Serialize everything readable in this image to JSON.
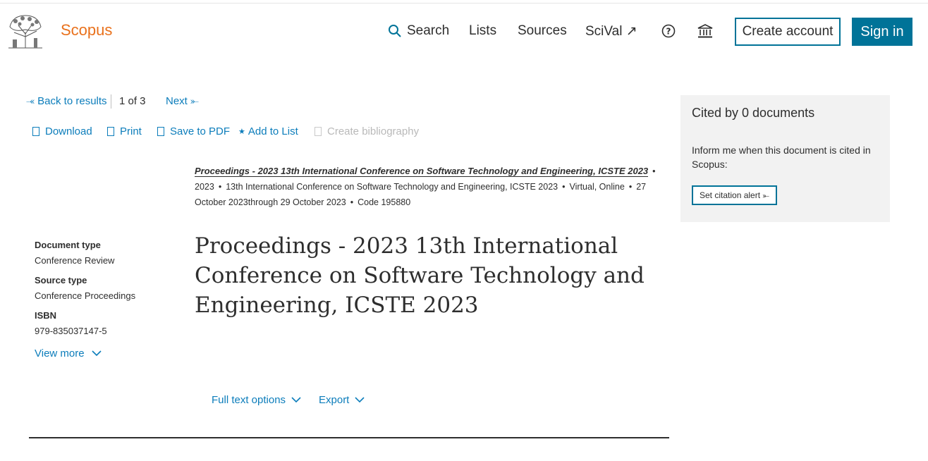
{
  "header": {
    "brand": "Scopus",
    "nav": {
      "search": "Search",
      "lists": "Lists",
      "sources": "Sources",
      "scival": "SciVal ↗"
    },
    "create_account": "Create account",
    "sign_in": "Sign in"
  },
  "toolbar": {
    "back": "⤛ Back to results",
    "pager": "1 of 3",
    "next": "Next ⤜",
    "download": "Download",
    "print": "Print",
    "save_pdf": "Save to PDF",
    "add_list": "Add to List",
    "create_bib": "Create bibliography"
  },
  "source": {
    "publication": "Proceedings - 2023 13th International Conference on Software Technology and Engineering, ICSTE 2023",
    "year": "2023",
    "conference": "13th International Conference on Software Technology and Engineering, ICSTE 2023",
    "location": "Virtual, Online",
    "dates": "27 October 2023through 29 October 2023",
    "code": "Code 195880"
  },
  "meta": {
    "doc_type_label": "Document type",
    "doc_type": "Conference Review",
    "source_type_label": "Source type",
    "source_type": "Conference Proceedings",
    "isbn_label": "ISBN",
    "isbn": "979-835037147-5",
    "view_more": "View more"
  },
  "document": {
    "title": "Proceedings - 2023 13th International Conference on Software Technology and Engineering, ICSTE 2023"
  },
  "options": {
    "full_text": "Full text options",
    "export": "Export"
  },
  "citations": {
    "cited_by": "Cited by 0 documents",
    "inform": "Inform me when this document is cited in Scopus:",
    "alert_button": "Set citation alert ⤜"
  },
  "colors": {
    "accent": "#007398",
    "brand": "#e9711c",
    "link": "#0c7dbb"
  }
}
